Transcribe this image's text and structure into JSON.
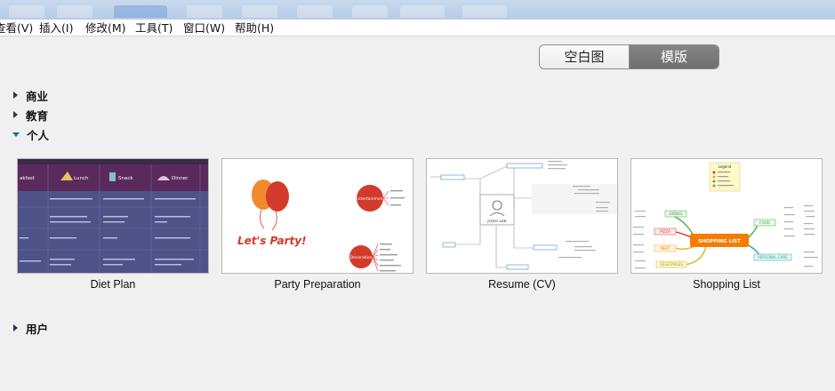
{
  "menu": {
    "view": "查看(V)",
    "insert": "插入(I)",
    "modify": "修改(M)",
    "tools": "工具(T)",
    "window": "窗口(W)",
    "help": "帮助(H)"
  },
  "toggle": {
    "blank": "空白图",
    "template": "模版"
  },
  "categories": {
    "business": "商业",
    "education": "教育",
    "personal": "个人",
    "user": "用户"
  },
  "templates": {
    "diet_plan": {
      "label": "Diet Plan",
      "headers": [
        "akfast",
        "Lunch",
        "Snack",
        "Dinner"
      ]
    },
    "party": {
      "label": "Party Preparation",
      "title": "Let's Party!",
      "node1": "Entertainment",
      "node2": "Decoration"
    },
    "resume": {
      "label": "Resume (CV)",
      "center": "JOHN LEE"
    },
    "shopping": {
      "label": "Shopping List",
      "center": "SHOPPING LIST",
      "legend_title": "Legend",
      "branches": [
        "DRINKS",
        "PIZZA",
        "MEAT",
        "FOOD",
        "VEGETABLES",
        "PERSONAL CARE"
      ]
    }
  },
  "colors": {
    "segment_active": "#767676",
    "diet_header": "#5a2a5c",
    "diet_body": "#4e5287",
    "party_red": "#d33a2c",
    "shopping_orange": "#f57c00"
  }
}
